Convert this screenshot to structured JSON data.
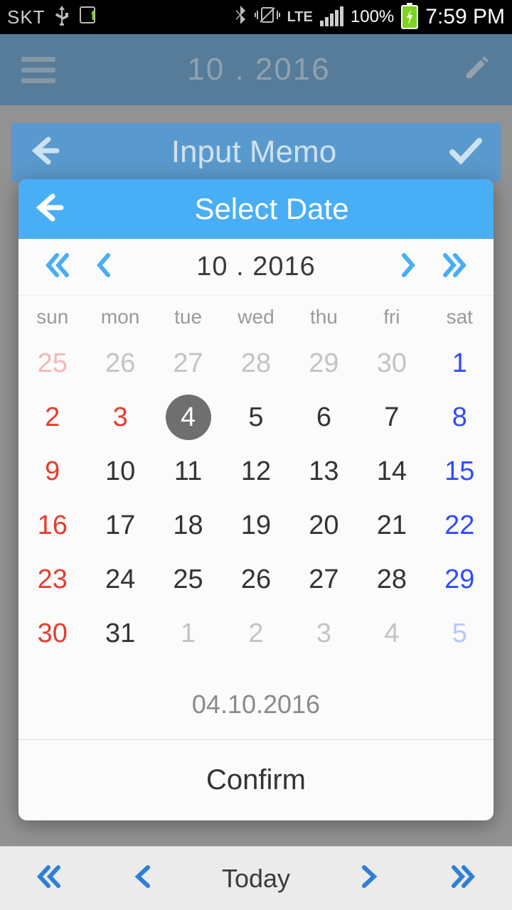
{
  "status": {
    "carrier": "SKT",
    "lte": "LTE",
    "battery": "100%",
    "time": "7:59 PM"
  },
  "app_header": {
    "title": "10 . 2016"
  },
  "memo_bar": {
    "title": "Input Memo"
  },
  "modal": {
    "title": "Select Date",
    "month_label": "10 . 2016",
    "weekdays": [
      "sun",
      "mon",
      "tue",
      "wed",
      "thu",
      "fri",
      "sat"
    ],
    "days": [
      {
        "n": "25",
        "cls": "outside sun"
      },
      {
        "n": "26",
        "cls": "outside"
      },
      {
        "n": "27",
        "cls": "outside"
      },
      {
        "n": "28",
        "cls": "outside"
      },
      {
        "n": "29",
        "cls": "outside"
      },
      {
        "n": "30",
        "cls": "outside"
      },
      {
        "n": "1",
        "cls": "sat"
      },
      {
        "n": "2",
        "cls": "sun"
      },
      {
        "n": "3",
        "cls": "sun"
      },
      {
        "n": "4",
        "cls": "selected"
      },
      {
        "n": "5",
        "cls": ""
      },
      {
        "n": "6",
        "cls": ""
      },
      {
        "n": "7",
        "cls": ""
      },
      {
        "n": "8",
        "cls": "sat"
      },
      {
        "n": "9",
        "cls": "sun"
      },
      {
        "n": "10",
        "cls": ""
      },
      {
        "n": "11",
        "cls": ""
      },
      {
        "n": "12",
        "cls": ""
      },
      {
        "n": "13",
        "cls": ""
      },
      {
        "n": "14",
        "cls": ""
      },
      {
        "n": "15",
        "cls": "sat"
      },
      {
        "n": "16",
        "cls": "sun"
      },
      {
        "n": "17",
        "cls": ""
      },
      {
        "n": "18",
        "cls": ""
      },
      {
        "n": "19",
        "cls": ""
      },
      {
        "n": "20",
        "cls": ""
      },
      {
        "n": "21",
        "cls": ""
      },
      {
        "n": "22",
        "cls": "sat"
      },
      {
        "n": "23",
        "cls": "sun"
      },
      {
        "n": "24",
        "cls": ""
      },
      {
        "n": "25",
        "cls": ""
      },
      {
        "n": "26",
        "cls": ""
      },
      {
        "n": "27",
        "cls": ""
      },
      {
        "n": "28",
        "cls": ""
      },
      {
        "n": "29",
        "cls": "sat"
      },
      {
        "n": "30",
        "cls": "sun"
      },
      {
        "n": "31",
        "cls": ""
      },
      {
        "n": "1",
        "cls": "outside"
      },
      {
        "n": "2",
        "cls": "outside"
      },
      {
        "n": "3",
        "cls": "outside"
      },
      {
        "n": "4",
        "cls": "outside"
      },
      {
        "n": "5",
        "cls": "outside sat"
      }
    ],
    "selected_date": "04.10.2016",
    "confirm": "Confirm"
  },
  "bottom_nav": {
    "today": "Today"
  },
  "colors": {
    "accent": "#48aef5"
  }
}
